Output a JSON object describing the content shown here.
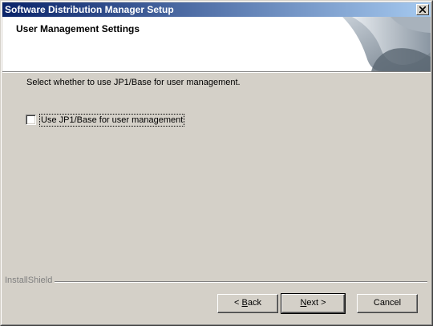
{
  "window": {
    "title": "Software Distribution Manager Setup"
  },
  "header": {
    "title": "User Management Settings",
    "graphic_icon": "installshield-banner-graphic"
  },
  "body": {
    "instruction": "Select whether to use JP1/Base for user management.",
    "checkbox": {
      "label": "Use JP1/Base for user management",
      "checked": false
    }
  },
  "footer": {
    "brand": "InstallShield"
  },
  "buttons": {
    "back_mnemonic": "B",
    "back_rest": "ack",
    "back_prefix": "< ",
    "next_mnemonic": "N",
    "next_rest": "ext >",
    "cancel": "Cancel"
  },
  "colors": {
    "titlebar_start": "#0a246a",
    "titlebar_end": "#a6caf0",
    "dialog_bg": "#d4d0c8"
  }
}
